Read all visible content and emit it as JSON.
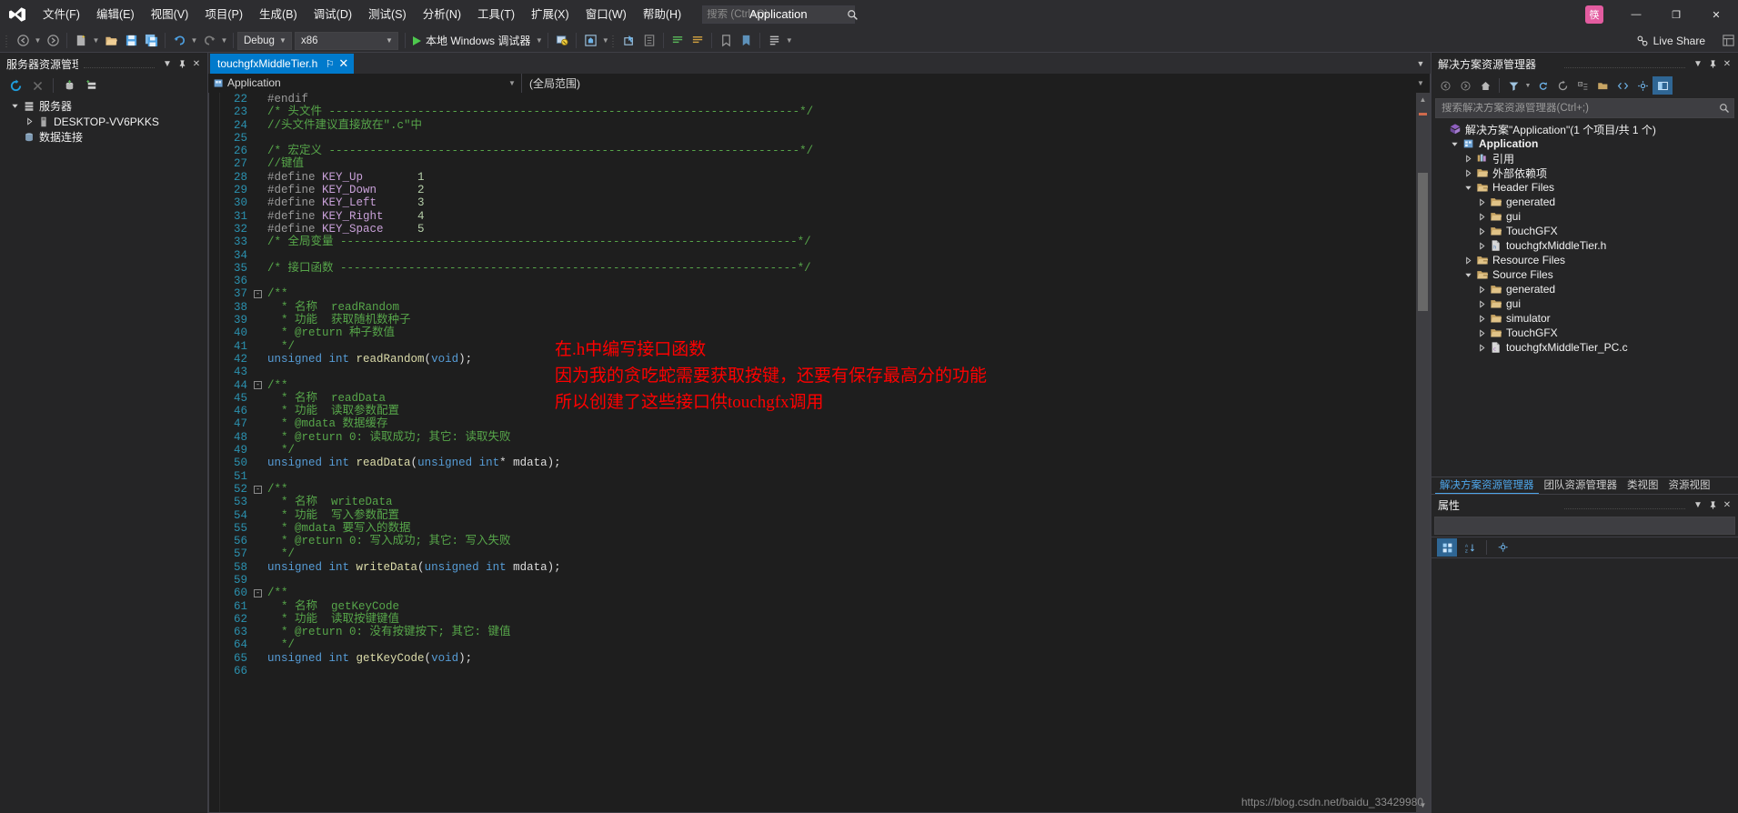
{
  "window": {
    "app_title": "Application",
    "user_badge": "筷",
    "minimize": "—",
    "maximize": "❐",
    "close": "✕"
  },
  "menu": {
    "items": [
      {
        "label": "文件(F)",
        "name": "menu-file"
      },
      {
        "label": "编辑(E)",
        "name": "menu-edit"
      },
      {
        "label": "视图(V)",
        "name": "menu-view"
      },
      {
        "label": "项目(P)",
        "name": "menu-project"
      },
      {
        "label": "生成(B)",
        "name": "menu-build"
      },
      {
        "label": "调试(D)",
        "name": "menu-debug"
      },
      {
        "label": "测试(S)",
        "name": "menu-test"
      },
      {
        "label": "分析(N)",
        "name": "menu-analyze"
      },
      {
        "label": "工具(T)",
        "name": "menu-tools"
      },
      {
        "label": "扩展(X)",
        "name": "menu-extensions"
      },
      {
        "label": "窗口(W)",
        "name": "menu-window"
      },
      {
        "label": "帮助(H)",
        "name": "menu-help"
      }
    ]
  },
  "search": {
    "placeholder": "搜索 (Ctrl+Q)",
    "value": ""
  },
  "toolbar": {
    "config_value": "Debug",
    "platform_value": "x86",
    "run_label": "本地 Windows 调试器",
    "live_share_label": "Live Share"
  },
  "server_explorer": {
    "title": "服务器资源管理器",
    "nodes": [
      {
        "label": "服务器",
        "level": 0,
        "expanded": true,
        "icon": "server-icon"
      },
      {
        "label": "DESKTOP-VV6PKKS",
        "level": 1,
        "expanded": false,
        "icon": "machine-icon"
      },
      {
        "label": "数据连接",
        "level": 0,
        "expanded": false,
        "icon": "data-connections-icon"
      }
    ]
  },
  "editor": {
    "tab_name": "touchgfxMiddleTier.h",
    "tab_pin": "⚐",
    "tab_close": "✕",
    "nav_left": "Application",
    "nav_right": "(全局范围)",
    "first_line_number": 22,
    "lines": [
      {
        "n": 22,
        "tokens": [
          {
            "t": "#endif",
            "c": "c-macro"
          }
        ]
      },
      {
        "n": 23,
        "tokens": [
          {
            "t": "/* 头文件 ---------------------------------------------------------------------*/",
            "c": "c-green"
          }
        ]
      },
      {
        "n": 24,
        "tokens": [
          {
            "t": "//头文件建议直接放在\".c\"中",
            "c": "c-green"
          }
        ]
      },
      {
        "n": 25,
        "tokens": [
          {
            "t": "",
            "c": "c-plain"
          }
        ]
      },
      {
        "n": 26,
        "tokens": [
          {
            "t": "/* 宏定义 ---------------------------------------------------------------------*/",
            "c": "c-green"
          }
        ]
      },
      {
        "n": 27,
        "tokens": [
          {
            "t": "//键值",
            "c": "c-green"
          }
        ]
      },
      {
        "n": 28,
        "tokens": [
          {
            "t": "#define ",
            "c": "c-macro"
          },
          {
            "t": "KEY_Up",
            "c": "c-def"
          },
          {
            "t": "        ",
            "c": "c-plain"
          },
          {
            "t": "1",
            "c": "c-num"
          }
        ]
      },
      {
        "n": 29,
        "tokens": [
          {
            "t": "#define ",
            "c": "c-macro"
          },
          {
            "t": "KEY_Down",
            "c": "c-def"
          },
          {
            "t": "      ",
            "c": "c-plain"
          },
          {
            "t": "2",
            "c": "c-num"
          }
        ]
      },
      {
        "n": 30,
        "tokens": [
          {
            "t": "#define ",
            "c": "c-macro"
          },
          {
            "t": "KEY_Left",
            "c": "c-def"
          },
          {
            "t": "      ",
            "c": "c-plain"
          },
          {
            "t": "3",
            "c": "c-num"
          }
        ]
      },
      {
        "n": 31,
        "tokens": [
          {
            "t": "#define ",
            "c": "c-macro"
          },
          {
            "t": "KEY_Right",
            "c": "c-def"
          },
          {
            "t": "     ",
            "c": "c-plain"
          },
          {
            "t": "4",
            "c": "c-num"
          }
        ]
      },
      {
        "n": 32,
        "tokens": [
          {
            "t": "#define ",
            "c": "c-macro"
          },
          {
            "t": "KEY_Space",
            "c": "c-def"
          },
          {
            "t": "     ",
            "c": "c-plain"
          },
          {
            "t": "5",
            "c": "c-num"
          }
        ]
      },
      {
        "n": 33,
        "tokens": [
          {
            "t": "/* 全局变量 -------------------------------------------------------------------*/",
            "c": "c-green"
          }
        ]
      },
      {
        "n": 34,
        "tokens": [
          {
            "t": "",
            "c": "c-plain"
          }
        ]
      },
      {
        "n": 35,
        "tokens": [
          {
            "t": "/* 接口函数 -------------------------------------------------------------------*/",
            "c": "c-green"
          }
        ]
      },
      {
        "n": 36,
        "tokens": [
          {
            "t": "",
            "c": "c-plain"
          }
        ]
      },
      {
        "n": 37,
        "tokens": [
          {
            "t": "/**",
            "c": "c-green"
          }
        ],
        "fold": "minus"
      },
      {
        "n": 38,
        "tokens": [
          {
            "t": "  * 名称  readRandom",
            "c": "c-green"
          }
        ]
      },
      {
        "n": 39,
        "tokens": [
          {
            "t": "  * 功能  获取随机数种子",
            "c": "c-green"
          }
        ]
      },
      {
        "n": 40,
        "tokens": [
          {
            "t": "  * @return 种子数值",
            "c": "c-green"
          }
        ]
      },
      {
        "n": 41,
        "tokens": [
          {
            "t": "  */",
            "c": "c-green"
          }
        ]
      },
      {
        "n": 42,
        "tokens": [
          {
            "t": "unsigned int",
            "c": "c-keyword"
          },
          {
            "t": " ",
            "c": "c-plain"
          },
          {
            "t": "readRandom",
            "c": "c-fn"
          },
          {
            "t": "(",
            "c": "c-plain"
          },
          {
            "t": "void",
            "c": "c-keyword"
          },
          {
            "t": ");",
            "c": "c-plain"
          }
        ]
      },
      {
        "n": 43,
        "tokens": [
          {
            "t": "",
            "c": "c-plain"
          }
        ]
      },
      {
        "n": 44,
        "tokens": [
          {
            "t": "/**",
            "c": "c-green"
          }
        ],
        "fold": "minus"
      },
      {
        "n": 45,
        "tokens": [
          {
            "t": "  * 名称  readData",
            "c": "c-green"
          }
        ]
      },
      {
        "n": 46,
        "tokens": [
          {
            "t": "  * 功能  读取参数配置",
            "c": "c-green"
          }
        ]
      },
      {
        "n": 47,
        "tokens": [
          {
            "t": "  * @mdata 数据缓存",
            "c": "c-green"
          }
        ]
      },
      {
        "n": 48,
        "tokens": [
          {
            "t": "  * @return 0: 读取成功; 其它: 读取失败",
            "c": "c-green"
          }
        ]
      },
      {
        "n": 49,
        "tokens": [
          {
            "t": "  */",
            "c": "c-green"
          }
        ]
      },
      {
        "n": 50,
        "tokens": [
          {
            "t": "unsigned int",
            "c": "c-keyword"
          },
          {
            "t": " ",
            "c": "c-plain"
          },
          {
            "t": "readData",
            "c": "c-fn"
          },
          {
            "t": "(",
            "c": "c-plain"
          },
          {
            "t": "unsigned int",
            "c": "c-keyword"
          },
          {
            "t": "* mdata);",
            "c": "c-plain"
          }
        ]
      },
      {
        "n": 51,
        "tokens": [
          {
            "t": "",
            "c": "c-plain"
          }
        ]
      },
      {
        "n": 52,
        "tokens": [
          {
            "t": "/**",
            "c": "c-green"
          }
        ],
        "fold": "minus"
      },
      {
        "n": 53,
        "tokens": [
          {
            "t": "  * 名称  writeData",
            "c": "c-green"
          }
        ]
      },
      {
        "n": 54,
        "tokens": [
          {
            "t": "  * 功能  写入参数配置",
            "c": "c-green"
          }
        ]
      },
      {
        "n": 55,
        "tokens": [
          {
            "t": "  * @mdata 要写入的数据",
            "c": "c-green"
          }
        ]
      },
      {
        "n": 56,
        "tokens": [
          {
            "t": "  * @return 0: 写入成功; 其它: 写入失败",
            "c": "c-green"
          }
        ]
      },
      {
        "n": 57,
        "tokens": [
          {
            "t": "  */",
            "c": "c-green"
          }
        ]
      },
      {
        "n": 58,
        "tokens": [
          {
            "t": "unsigned int",
            "c": "c-keyword"
          },
          {
            "t": " ",
            "c": "c-plain"
          },
          {
            "t": "writeData",
            "c": "c-fn"
          },
          {
            "t": "(",
            "c": "c-plain"
          },
          {
            "t": "unsigned int",
            "c": "c-keyword"
          },
          {
            "t": " mdata);",
            "c": "c-plain"
          }
        ]
      },
      {
        "n": 59,
        "tokens": [
          {
            "t": "",
            "c": "c-plain"
          }
        ]
      },
      {
        "n": 60,
        "tokens": [
          {
            "t": "/**",
            "c": "c-green"
          }
        ],
        "fold": "minus"
      },
      {
        "n": 61,
        "tokens": [
          {
            "t": "  * 名称  getKeyCode",
            "c": "c-green"
          }
        ]
      },
      {
        "n": 62,
        "tokens": [
          {
            "t": "  * 功能  读取按键键值",
            "c": "c-green"
          }
        ]
      },
      {
        "n": 63,
        "tokens": [
          {
            "t": "  * @return 0: 没有按键按下; 其它: 键值",
            "c": "c-green"
          }
        ]
      },
      {
        "n": 64,
        "tokens": [
          {
            "t": "  */",
            "c": "c-green"
          }
        ]
      },
      {
        "n": 65,
        "tokens": [
          {
            "t": "unsigned int",
            "c": "c-keyword"
          },
          {
            "t": " ",
            "c": "c-plain"
          },
          {
            "t": "getKeyCode",
            "c": "c-fn"
          },
          {
            "t": "(",
            "c": "c-plain"
          },
          {
            "t": "void",
            "c": "c-keyword"
          },
          {
            "t": ");",
            "c": "c-plain"
          }
        ]
      },
      {
        "n": 66,
        "tokens": [
          {
            "t": "",
            "c": "c-plain"
          }
        ]
      }
    ],
    "annotations": [
      {
        "text": "在.h中编写接口函数",
        "color": "#ff0000"
      },
      {
        "text": "因为我的贪吃蛇需要获取按键，还要有保存最高分的功能",
        "color": "#ff0000"
      },
      {
        "text": "所以创建了这些接口供touchgfx调用",
        "color": "#ff0000"
      }
    ]
  },
  "solution_explorer": {
    "title": "解决方案资源管理器",
    "search_placeholder": "搜索解决方案资源管理器(Ctrl+;)",
    "search_value": "",
    "nodes": [
      {
        "label": "解决方案\"Application\"(1 个项目/共 1 个)",
        "level": 0,
        "expander": "none",
        "icon": "solution-icon",
        "bold": false
      },
      {
        "label": "Application",
        "level": 1,
        "expander": "open",
        "icon": "project-icon",
        "bold": true
      },
      {
        "label": "引用",
        "level": 2,
        "expander": "closed",
        "icon": "references-icon",
        "bold": false
      },
      {
        "label": "外部依赖项",
        "level": 2,
        "expander": "closed",
        "icon": "folder-ext-icon",
        "bold": false
      },
      {
        "label": "Header Files",
        "level": 2,
        "expander": "open",
        "icon": "filter-icon",
        "bold": false
      },
      {
        "label": "generated",
        "level": 3,
        "expander": "closed",
        "icon": "folder-icon",
        "bold": false
      },
      {
        "label": "gui",
        "level": 3,
        "expander": "closed",
        "icon": "folder-icon",
        "bold": false
      },
      {
        "label": "TouchGFX",
        "level": 3,
        "expander": "closed",
        "icon": "folder-icon",
        "bold": false
      },
      {
        "label": "touchgfxMiddleTier.h",
        "level": 3,
        "expander": "closed",
        "icon": "header-file-icon",
        "bold": false
      },
      {
        "label": "Resource Files",
        "level": 2,
        "expander": "closed",
        "icon": "filter-icon",
        "bold": false
      },
      {
        "label": "Source Files",
        "level": 2,
        "expander": "open",
        "icon": "filter-icon",
        "bold": false
      },
      {
        "label": "generated",
        "level": 3,
        "expander": "closed",
        "icon": "folder-icon",
        "bold": false
      },
      {
        "label": "gui",
        "level": 3,
        "expander": "closed",
        "icon": "folder-icon",
        "bold": false
      },
      {
        "label": "simulator",
        "level": 3,
        "expander": "closed",
        "icon": "folder-icon",
        "bold": false
      },
      {
        "label": "TouchGFX",
        "level": 3,
        "expander": "closed",
        "icon": "folder-icon",
        "bold": false
      },
      {
        "label": "touchgfxMiddleTier_PC.c",
        "level": 3,
        "expander": "closed",
        "icon": "c-file-icon",
        "bold": false
      }
    ],
    "bottom_tabs": [
      {
        "label": "解决方案资源管理器",
        "active": true
      },
      {
        "label": "团队资源管理器",
        "active": false
      },
      {
        "label": "类视图",
        "active": false
      },
      {
        "label": "资源视图",
        "active": false
      }
    ]
  },
  "properties": {
    "title": "属性"
  },
  "watermark": "https://blog.csdn.net/baidu_33429980"
}
